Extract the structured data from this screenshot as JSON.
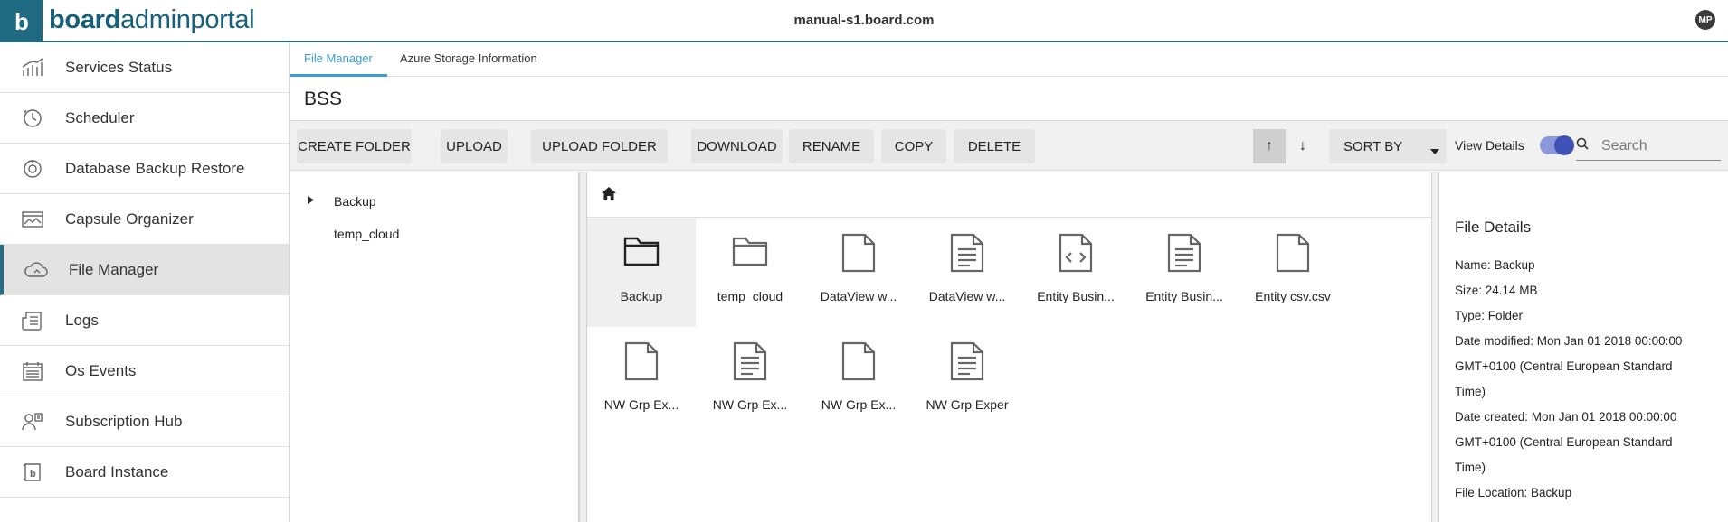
{
  "app": {
    "brand_bold": "board",
    "brand_light": "adminportal",
    "logo_letter": "b",
    "host": "manual-s1.board.com",
    "avatar_initials": "MP"
  },
  "sidebar": {
    "items": [
      {
        "label": "Services Status",
        "icon": "services-status-icon"
      },
      {
        "label": "Scheduler",
        "icon": "scheduler-icon"
      },
      {
        "label": "Database Backup Restore",
        "icon": "database-backup-icon"
      },
      {
        "label": "Capsule Organizer",
        "icon": "capsule-organizer-icon"
      },
      {
        "label": "File Manager",
        "icon": "file-manager-cloud-icon",
        "active": true
      },
      {
        "label": "Logs",
        "icon": "logs-icon"
      },
      {
        "label": "Os Events",
        "icon": "os-events-icon"
      },
      {
        "label": "Subscription Hub",
        "icon": "subscription-hub-icon"
      },
      {
        "label": "Board Instance",
        "icon": "board-instance-icon"
      }
    ]
  },
  "tabs": [
    {
      "label": "File Manager",
      "active": true
    },
    {
      "label": "Azure Storage Information",
      "active": false
    }
  ],
  "folder_title": "BSS",
  "toolbar": {
    "create_folder": "CREATE FOLDER",
    "upload": "UPLOAD",
    "upload_folder": "UPLOAD FOLDER",
    "download": "DOWNLOAD",
    "rename": "RENAME",
    "copy": "COPY",
    "delete": "DELETE",
    "sort_asc": "↑",
    "sort_desc": "↓",
    "sort_by": "SORT BY",
    "view_details": "View Details",
    "view_details_on": true,
    "search_placeholder": "Search"
  },
  "tree": {
    "items": [
      {
        "label": "Backup",
        "expandable": true
      },
      {
        "label": "temp_cloud",
        "expandable": false
      }
    ]
  },
  "files": [
    {
      "name": "Backup",
      "type": "folder",
      "selected": true
    },
    {
      "name": "temp_cloud",
      "type": "folder"
    },
    {
      "name": "DataView w...",
      "type": "file-blank"
    },
    {
      "name": "DataView w...",
      "type": "file-text"
    },
    {
      "name": "Entity Busin...",
      "type": "file-code"
    },
    {
      "name": "Entity Busin...",
      "type": "file-text"
    },
    {
      "name": "Entity csv.csv",
      "type": "file-blank"
    },
    {
      "name": "NW Grp Ex...",
      "type": "file-blank"
    },
    {
      "name": "NW Grp Ex...",
      "type": "file-text"
    },
    {
      "name": "NW Grp Ex...",
      "type": "file-blank"
    },
    {
      "name": "NW Grp Exper",
      "type": "file-text"
    }
  ],
  "details": {
    "title": "File Details",
    "name": "Name: Backup",
    "size": "Size: 24.14 MB",
    "type": "Type: Folder",
    "modified_1": "Date modified: Mon Jan 01 2018 00:00:00",
    "modified_2": "GMT+0100 (Central European Standard",
    "modified_3": "Time)",
    "created_1": "Date created: Mon Jan 01 2018 00:00:00",
    "created_2": "GMT+0100 (Central European Standard",
    "created_3": "Time)",
    "location": "File Location: Backup"
  },
  "colors": {
    "brand": "#1e6a80",
    "accent_tab": "#3b9bd3",
    "toggle": "#3f51b5"
  }
}
